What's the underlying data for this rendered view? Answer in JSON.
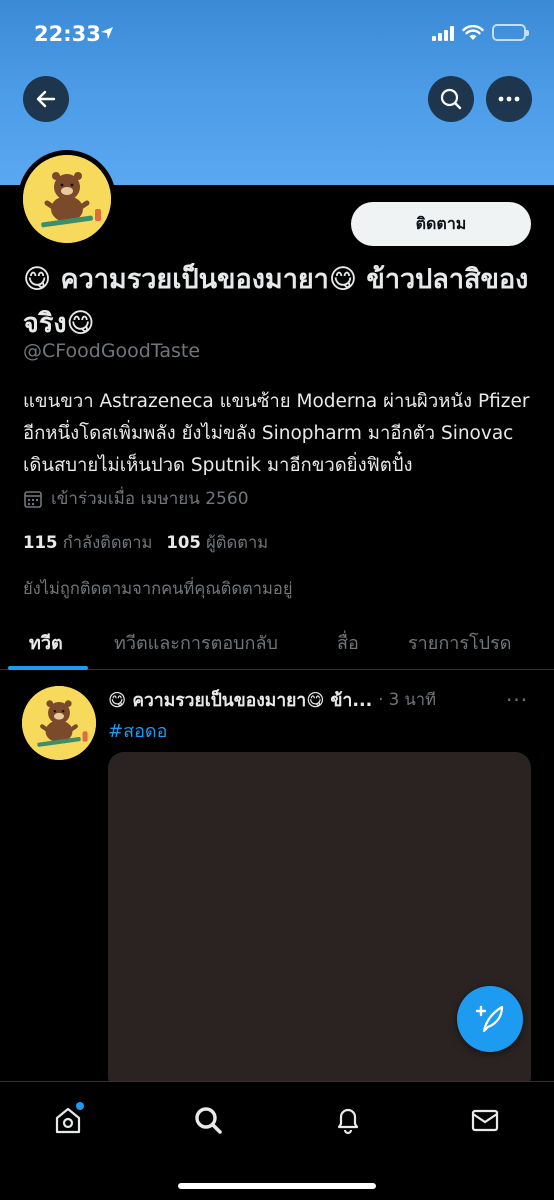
{
  "status_bar": {
    "time": "22:33"
  },
  "colors": {
    "accent": "#1d9bf0",
    "banner": "#4a9ae6",
    "background": "#000000",
    "avatar_bg": "#f7d95c"
  },
  "header": {
    "back_icon": "arrow-left-icon",
    "search_icon": "search-icon",
    "more_icon": "more-horizontal-icon"
  },
  "profile": {
    "follow_label": "ติดตาม",
    "display_name": "😋 ความรวยเป็นของมายา😋 ข้าวปลาสิของจริง😋",
    "handle": "@CFoodGoodTaste",
    "bio": "แขนขวา Astrazeneca แขนซ้าย Moderna ผ่านผิวหนัง Pfizer อีกหนึ่งโดสเพิ่มพลัง ยังไม่ขลัง Sinopharm มาอีกตัว Sinovac เดินสบายไม่เห็นปวด Sputnik มาอีกขวดยิ่งฟิตปั๋ง",
    "joined": "เข้าร่วมเมื่อ เมษายน 2560",
    "following_count": "115",
    "following_label": "กำลังติดตาม",
    "followers_count": "105",
    "followers_label": "ผู้ติดตาม",
    "not_followed_note": "ยังไม่ถูกติดตามจากคนที่คุณติดตามอยู่"
  },
  "tabs": [
    {
      "label": "ทวีต",
      "active": true
    },
    {
      "label": "ทวีตและการตอบกลับ",
      "active": false
    },
    {
      "label": "สื่อ",
      "active": false
    },
    {
      "label": "รายการโปรด",
      "active": false
    }
  ],
  "tweet": {
    "author": "😋 ความรวยเป็นของมายา😋 ข้า...",
    "time": "· 3 นาที",
    "more": "···",
    "hashtag": "#สอดอ"
  },
  "bottom_nav": [
    {
      "icon": "home-icon",
      "has_notification_dot": true
    },
    {
      "icon": "search-icon"
    },
    {
      "icon": "bell-icon"
    },
    {
      "icon": "mail-icon"
    }
  ],
  "fab": {
    "icon": "compose-tweet-icon"
  }
}
